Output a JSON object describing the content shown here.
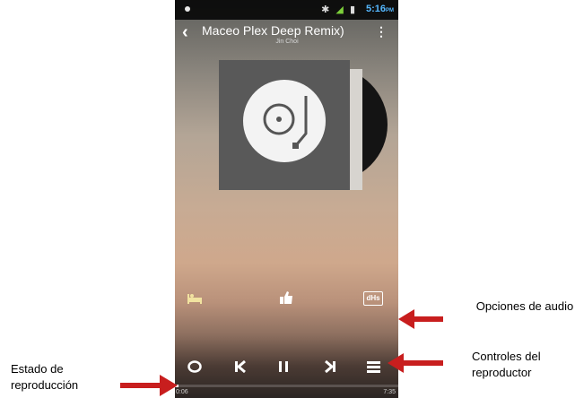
{
  "status_bar": {
    "time": "5:16",
    "ampm": "PM",
    "icons_text": "✱ ▮ ▮"
  },
  "track": {
    "title": "Maceo Plex Deep Remix)",
    "artist": "Jin Choi"
  },
  "icons": {
    "back": "‹",
    "menu": "⋮"
  },
  "audio_options": {
    "sleep_icon": "sleep-timer-icon",
    "like_icon": "thumbs-up-icon",
    "eq_label": "dHs"
  },
  "controls": {
    "repeat": "repeat-icon",
    "previous": "previous-icon",
    "pause": "pause-icon",
    "next": "next-icon",
    "playlist": "playlist-icon"
  },
  "playback": {
    "elapsed": "0:06",
    "total": "7:35",
    "progress_fraction": 0.016
  },
  "annotations": {
    "audio_options": "Opciones de audio",
    "player_controls": "Controles del reproductor",
    "playback_status": "Estado de reproducción"
  },
  "colors": {
    "arrow": "#c81e1e",
    "time_accent": "#55b8ff"
  }
}
